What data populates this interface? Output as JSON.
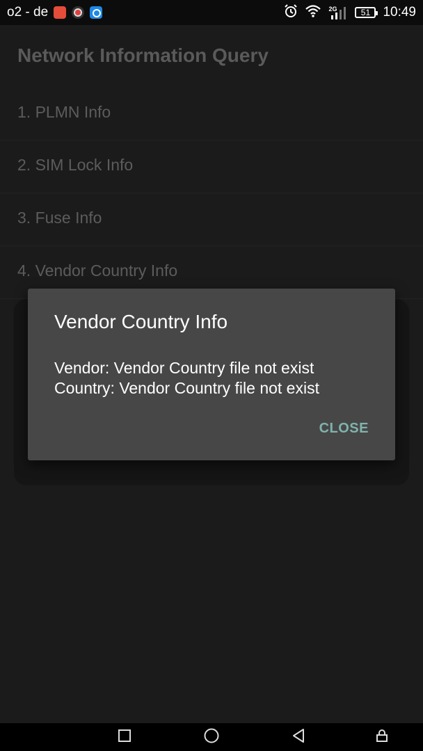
{
  "status_bar": {
    "carrier": "o2 - de",
    "network_tag": "2G",
    "battery": "51",
    "time": "10:49"
  },
  "header": {
    "title": "Network Information Query"
  },
  "menu": {
    "items": [
      {
        "label": "1. PLMN Info"
      },
      {
        "label": "2. SIM Lock Info"
      },
      {
        "label": "3. Fuse Info"
      },
      {
        "label": "4. Vendor Country Info"
      }
    ]
  },
  "dialog": {
    "title": "Vendor Country Info",
    "line1": "Vendor: Vendor Country file not exist",
    "line2": "Country: Vendor Country file not exist",
    "close_label": "CLOSE"
  },
  "colors": {
    "background": "#1b1b1b",
    "dialog": "#474747",
    "accent": "#80b3ad"
  }
}
